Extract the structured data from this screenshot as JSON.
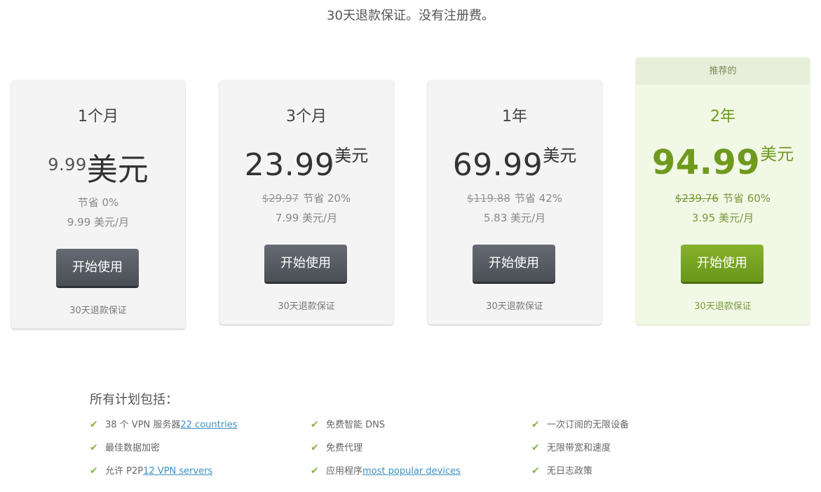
{
  "header": {
    "guarantee_text": "30天退款保证。没有注册费。"
  },
  "plans": [
    {
      "name": "1个月",
      "price": "9.99",
      "currency": "美元",
      "old_price": "",
      "savings": "节省 0%",
      "per_month": "9.99 美元/月",
      "button": "开始使用",
      "guarantee": "30天退款保证"
    },
    {
      "name": "3个月",
      "price": "23.99",
      "currency": "美元",
      "old_price": "$29.97",
      "savings": "节省 20%",
      "per_month": "7.99 美元/月",
      "button": "开始使用",
      "guarantee": "30天退款保证"
    },
    {
      "name": "1年",
      "price": "69.99",
      "currency": "美元",
      "old_price": "$119.88",
      "savings": "节省 42%",
      "per_month": "5.83 美元/月",
      "button": "开始使用",
      "guarantee": "30天退款保证"
    },
    {
      "name": "2年",
      "price": "94.99",
      "currency": "美元",
      "old_price": "$239.76",
      "savings": "节省 60%",
      "per_month": "3.95 美元/月",
      "button": "开始使用",
      "guarantee": "30天退款保证",
      "badge": "推荐的"
    }
  ],
  "features": {
    "title": "所有计划包括：",
    "items": [
      {
        "text": "38 个 VPN 服务器",
        "link": "22 countries"
      },
      {
        "text": "最佳数据加密",
        "link": ""
      },
      {
        "text": "允许 P2P",
        "link": "12 VPN servers"
      },
      {
        "text": "免费智能 DNS",
        "link": ""
      },
      {
        "text": "免费代理",
        "link": ""
      },
      {
        "text": "应用程序",
        "link": "most popular devices"
      },
      {
        "text": "一次订阅的无限设备",
        "link": ""
      },
      {
        "text": "无限带宽和速度",
        "link": ""
      },
      {
        "text": "无日志政策",
        "link": ""
      }
    ]
  },
  "colors": {
    "accent_green": "#6f9a1e",
    "button_dark": "#4a4f56",
    "link_blue": "#3a8fc2",
    "check_green": "#8ab34a"
  },
  "icons": {
    "feature_check": "checkmark-icon"
  }
}
